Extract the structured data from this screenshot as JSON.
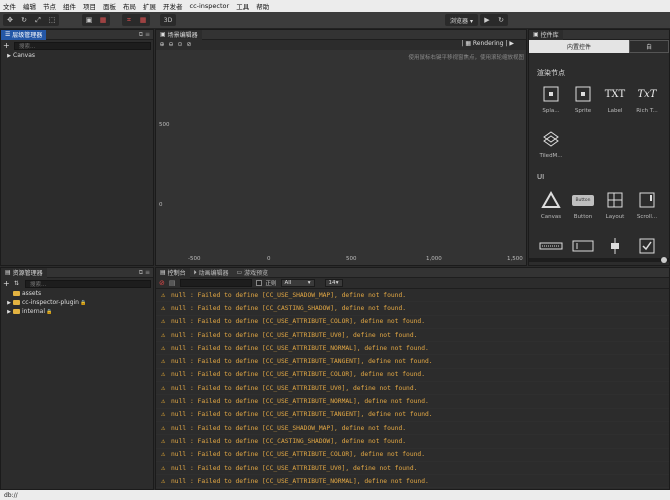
{
  "menu": [
    "文件",
    "编辑",
    "节点",
    "组件",
    "项目",
    "面板",
    "布局",
    "扩展",
    "开发者",
    "cc-inspector",
    "工具",
    "帮助"
  ],
  "toolbar": {
    "mode_3d": "3D",
    "browser_select": "浏览器 ▾",
    "play_icon": "play-icon",
    "refresh_icon": "refresh-icon"
  },
  "hierarchy": {
    "title": "层级管理器",
    "search_placeholder": "搜索...",
    "root": "Canvas"
  },
  "scene": {
    "title": "场景编辑器",
    "rendering": "Rendering",
    "hint": "使用鼠标右键平移视窗焦点，使用滚轮缩放视图",
    "y_labels": [
      "500",
      "0"
    ],
    "x_labels": [
      "-500",
      "0",
      "500",
      "1,000",
      "1,500"
    ]
  },
  "library": {
    "title": "控件库",
    "tab_builtin": "内置控件",
    "tab_custom": "自",
    "section_render": "渲染节点",
    "section_ui": "UI",
    "render_items": [
      "Spla...",
      "Sprite",
      "Label",
      "Rich T...",
      "TiledM..."
    ],
    "ui_items": [
      "Canvas",
      "Button",
      "Layout",
      "Scroll...",
      "Ed"
    ],
    "label_glyph": "TXT",
    "rich_glyph": "TxT",
    "button_glyph": "Button"
  },
  "assets": {
    "title": "资源管理器",
    "search_placeholder": "搜索...",
    "items": [
      "assets",
      "cc-inspector-plugin",
      "internal"
    ]
  },
  "console": {
    "tabs": [
      "控制台",
      "动画编辑器",
      "游戏预览"
    ],
    "regex_label": "正则",
    "level_select": "All",
    "font_size_select": "14",
    "lines": [
      "null : Failed to define [CC_USE_SHADOW_MAP], define not found.",
      "null : Failed to define [CC_CASTING_SHADOW], define not found.",
      "null : Failed to define [CC_USE_ATTRIBUTE_COLOR], define not found.",
      "null : Failed to define [CC_USE_ATTRIBUTE_UV0], define not found.",
      "null : Failed to define [CC_USE_ATTRIBUTE_NORMAL], define not found.",
      "null : Failed to define [CC_USE_ATTRIBUTE_TANGENT], define not found.",
      "null : Failed to define [CC_USE_ATTRIBUTE_COLOR], define not found.",
      "null : Failed to define [CC_USE_ATTRIBUTE_UV0], define not found.",
      "null : Failed to define [CC_USE_ATTRIBUTE_NORMAL], define not found.",
      "null : Failed to define [CC_USE_ATTRIBUTE_TANGENT], define not found.",
      "null : Failed to define [CC_USE_SHADOW_MAP], define not found.",
      "null : Failed to define [CC_CASTING_SHADOW], define not found.",
      "null : Failed to define [CC_USE_ATTRIBUTE_COLOR], define not found.",
      "null : Failed to define [CC_USE_ATTRIBUTE_UV0], define not found.",
      "null : Failed to define [CC_USE_ATTRIBUTE_NORMAL], define not found.",
      "null : Failed to define [CC_USE_ATTRIBUTE_TANGENT], define not found."
    ]
  },
  "status": {
    "text": "db://"
  },
  "colors": {
    "accent_blue": "#2457a6",
    "warning": "#e3a844",
    "folder": "#e3b341"
  }
}
